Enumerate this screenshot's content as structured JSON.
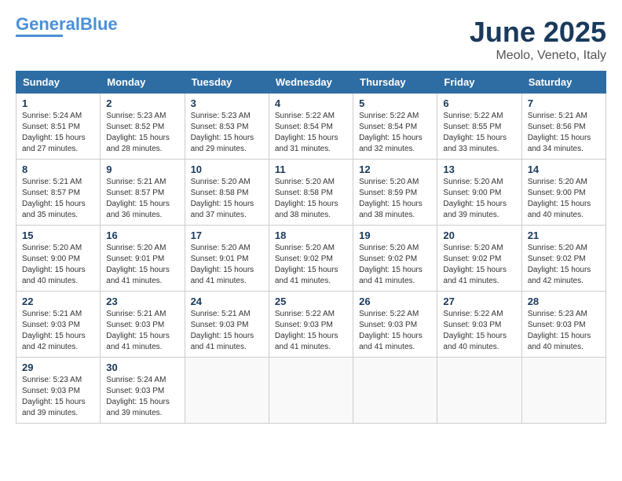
{
  "header": {
    "logo_general": "General",
    "logo_blue": "Blue",
    "title": "June 2025",
    "location": "Meolo, Veneto, Italy"
  },
  "weekdays": [
    "Sunday",
    "Monday",
    "Tuesday",
    "Wednesday",
    "Thursday",
    "Friday",
    "Saturday"
  ],
  "weeks": [
    [
      {
        "day": "1",
        "info": "Sunrise: 5:24 AM\nSunset: 8:51 PM\nDaylight: 15 hours\nand 27 minutes."
      },
      {
        "day": "2",
        "info": "Sunrise: 5:23 AM\nSunset: 8:52 PM\nDaylight: 15 hours\nand 28 minutes."
      },
      {
        "day": "3",
        "info": "Sunrise: 5:23 AM\nSunset: 8:53 PM\nDaylight: 15 hours\nand 29 minutes."
      },
      {
        "day": "4",
        "info": "Sunrise: 5:22 AM\nSunset: 8:54 PM\nDaylight: 15 hours\nand 31 minutes."
      },
      {
        "day": "5",
        "info": "Sunrise: 5:22 AM\nSunset: 8:54 PM\nDaylight: 15 hours\nand 32 minutes."
      },
      {
        "day": "6",
        "info": "Sunrise: 5:22 AM\nSunset: 8:55 PM\nDaylight: 15 hours\nand 33 minutes."
      },
      {
        "day": "7",
        "info": "Sunrise: 5:21 AM\nSunset: 8:56 PM\nDaylight: 15 hours\nand 34 minutes."
      }
    ],
    [
      {
        "day": "8",
        "info": "Sunrise: 5:21 AM\nSunset: 8:57 PM\nDaylight: 15 hours\nand 35 minutes."
      },
      {
        "day": "9",
        "info": "Sunrise: 5:21 AM\nSunset: 8:57 PM\nDaylight: 15 hours\nand 36 minutes."
      },
      {
        "day": "10",
        "info": "Sunrise: 5:20 AM\nSunset: 8:58 PM\nDaylight: 15 hours\nand 37 minutes."
      },
      {
        "day": "11",
        "info": "Sunrise: 5:20 AM\nSunset: 8:58 PM\nDaylight: 15 hours\nand 38 minutes."
      },
      {
        "day": "12",
        "info": "Sunrise: 5:20 AM\nSunset: 8:59 PM\nDaylight: 15 hours\nand 38 minutes."
      },
      {
        "day": "13",
        "info": "Sunrise: 5:20 AM\nSunset: 9:00 PM\nDaylight: 15 hours\nand 39 minutes."
      },
      {
        "day": "14",
        "info": "Sunrise: 5:20 AM\nSunset: 9:00 PM\nDaylight: 15 hours\nand 40 minutes."
      }
    ],
    [
      {
        "day": "15",
        "info": "Sunrise: 5:20 AM\nSunset: 9:00 PM\nDaylight: 15 hours\nand 40 minutes."
      },
      {
        "day": "16",
        "info": "Sunrise: 5:20 AM\nSunset: 9:01 PM\nDaylight: 15 hours\nand 41 minutes."
      },
      {
        "day": "17",
        "info": "Sunrise: 5:20 AM\nSunset: 9:01 PM\nDaylight: 15 hours\nand 41 minutes."
      },
      {
        "day": "18",
        "info": "Sunrise: 5:20 AM\nSunset: 9:02 PM\nDaylight: 15 hours\nand 41 minutes."
      },
      {
        "day": "19",
        "info": "Sunrise: 5:20 AM\nSunset: 9:02 PM\nDaylight: 15 hours\nand 41 minutes."
      },
      {
        "day": "20",
        "info": "Sunrise: 5:20 AM\nSunset: 9:02 PM\nDaylight: 15 hours\nand 41 minutes."
      },
      {
        "day": "21",
        "info": "Sunrise: 5:20 AM\nSunset: 9:02 PM\nDaylight: 15 hours\nand 42 minutes."
      }
    ],
    [
      {
        "day": "22",
        "info": "Sunrise: 5:21 AM\nSunset: 9:03 PM\nDaylight: 15 hours\nand 42 minutes."
      },
      {
        "day": "23",
        "info": "Sunrise: 5:21 AM\nSunset: 9:03 PM\nDaylight: 15 hours\nand 41 minutes."
      },
      {
        "day": "24",
        "info": "Sunrise: 5:21 AM\nSunset: 9:03 PM\nDaylight: 15 hours\nand 41 minutes."
      },
      {
        "day": "25",
        "info": "Sunrise: 5:22 AM\nSunset: 9:03 PM\nDaylight: 15 hours\nand 41 minutes."
      },
      {
        "day": "26",
        "info": "Sunrise: 5:22 AM\nSunset: 9:03 PM\nDaylight: 15 hours\nand 41 minutes."
      },
      {
        "day": "27",
        "info": "Sunrise: 5:22 AM\nSunset: 9:03 PM\nDaylight: 15 hours\nand 40 minutes."
      },
      {
        "day": "28",
        "info": "Sunrise: 5:23 AM\nSunset: 9:03 PM\nDaylight: 15 hours\nand 40 minutes."
      }
    ],
    [
      {
        "day": "29",
        "info": "Sunrise: 5:23 AM\nSunset: 9:03 PM\nDaylight: 15 hours\nand 39 minutes."
      },
      {
        "day": "30",
        "info": "Sunrise: 5:24 AM\nSunset: 9:03 PM\nDaylight: 15 hours\nand 39 minutes."
      },
      {
        "day": "",
        "info": ""
      },
      {
        "day": "",
        "info": ""
      },
      {
        "day": "",
        "info": ""
      },
      {
        "day": "",
        "info": ""
      },
      {
        "day": "",
        "info": ""
      }
    ]
  ]
}
